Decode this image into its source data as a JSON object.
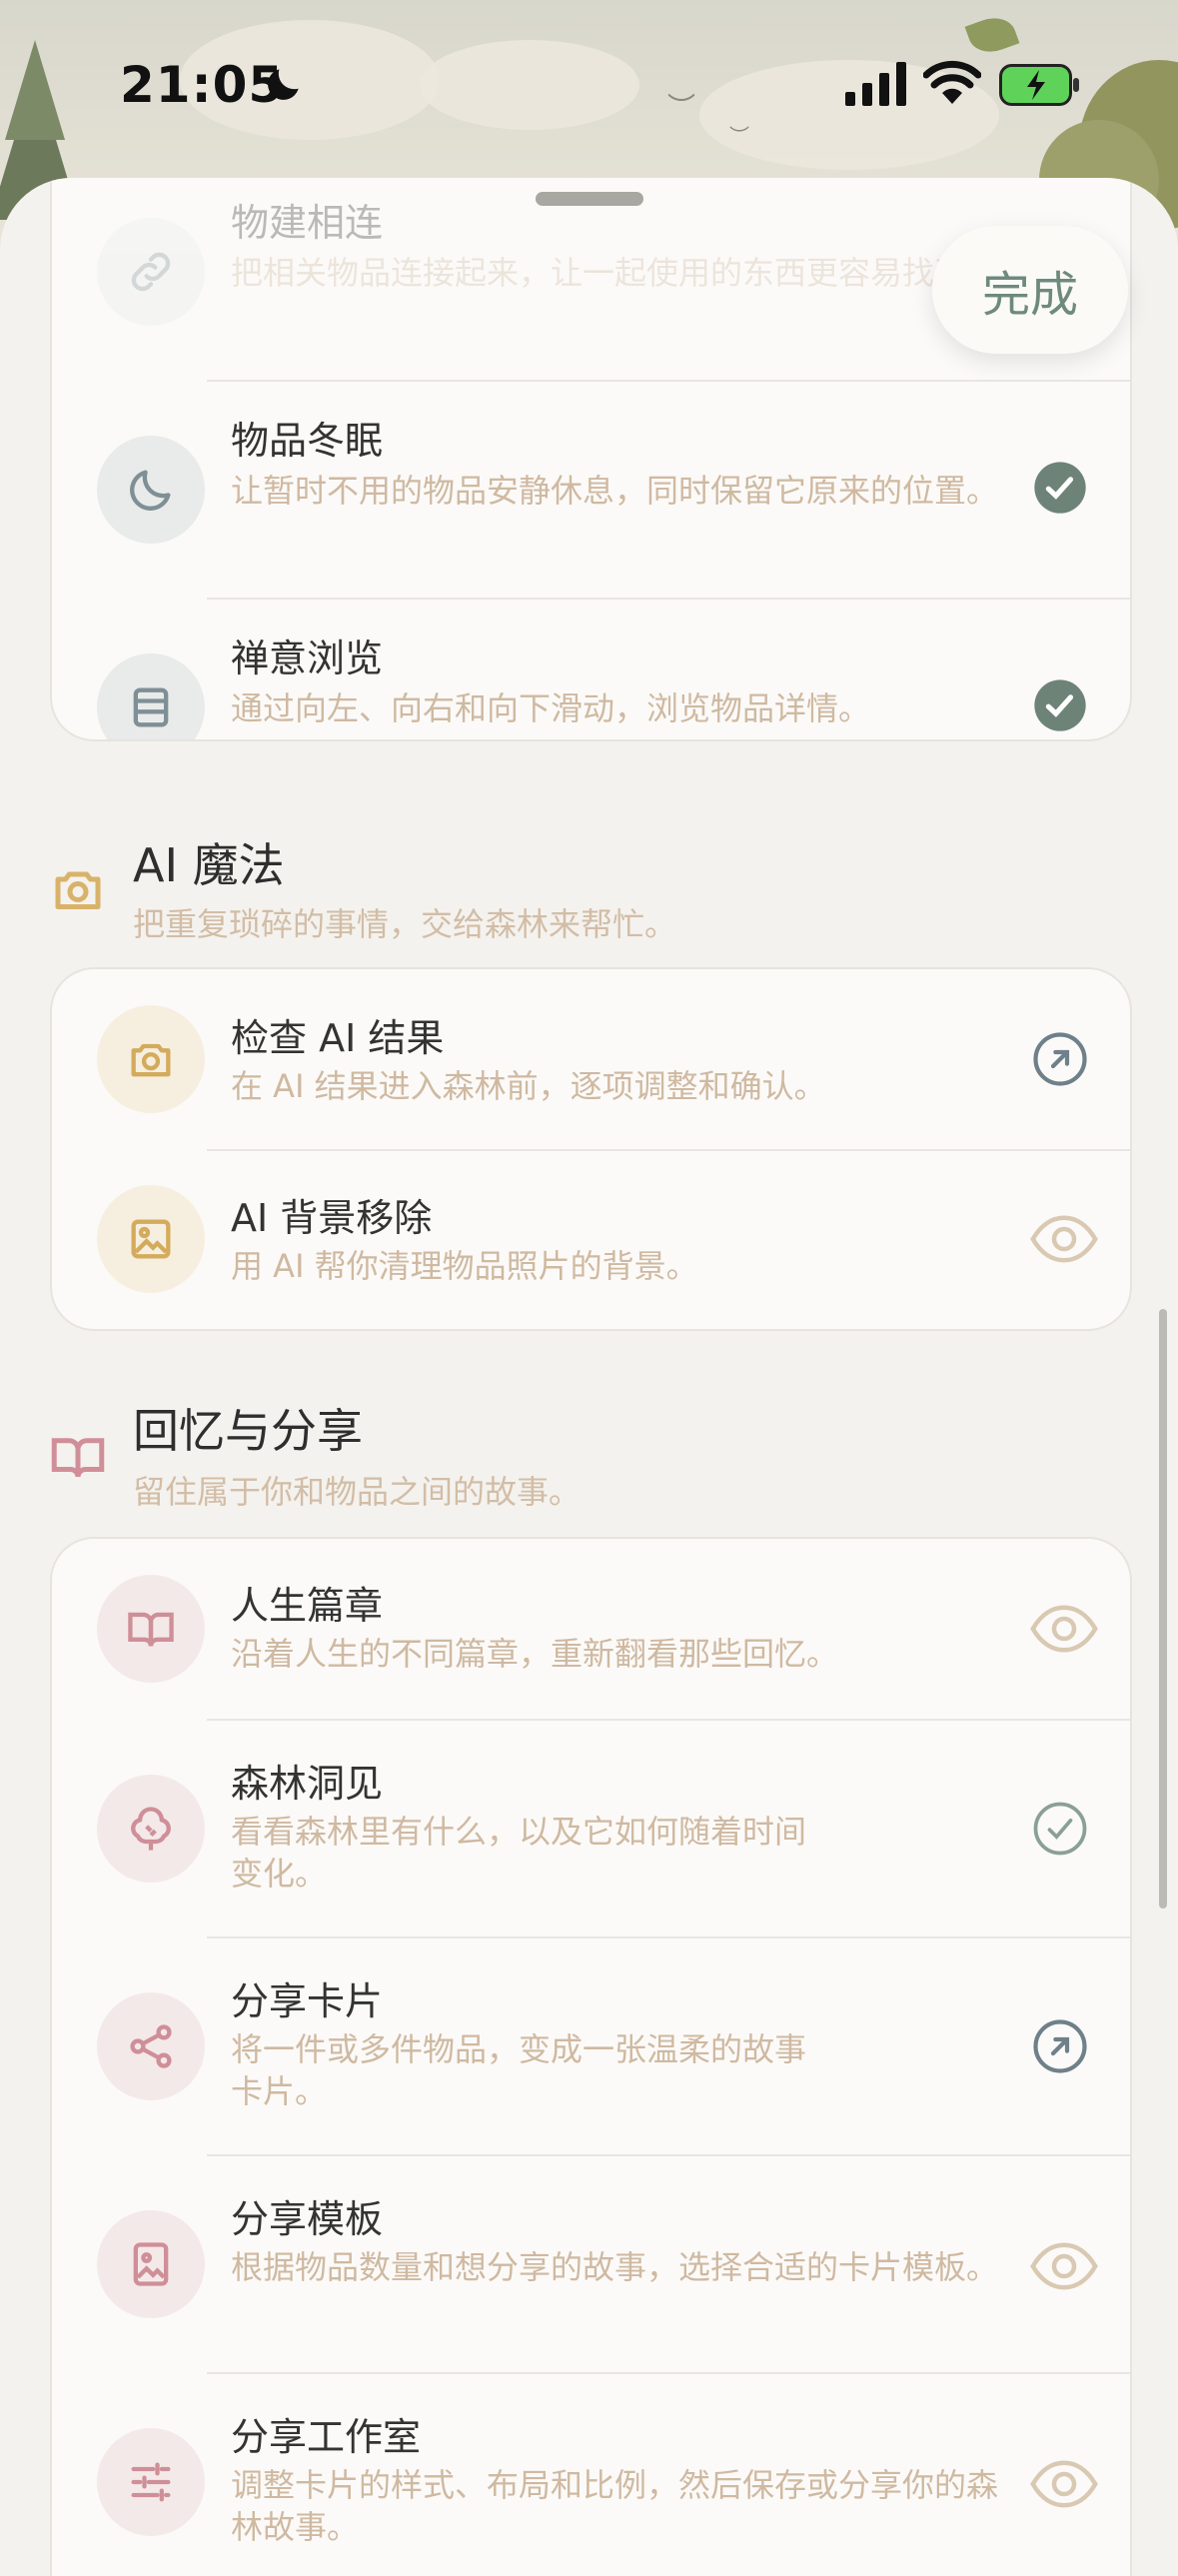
{
  "status_bar": {
    "time": "21:05"
  },
  "sheet": {
    "done_label": "完成"
  },
  "section_top": {
    "rows": [
      {
        "title": "物建相连",
        "desc": "把相关物品连接起来，让一起使用的东西更容易找到。",
        "icon": "link-icon",
        "status": "checked"
      },
      {
        "title": "物品冬眠",
        "desc": "让暂时不用的物品安静休息，同时保留它原来的位置。",
        "icon": "moon-icon",
        "status": "checked"
      },
      {
        "title": "禅意浏览",
        "desc": "通过向左、向右和向下滑动，浏览物品详情。",
        "icon": "list-icon",
        "status": "checked"
      }
    ]
  },
  "section_ai": {
    "title": "AI 魔法",
    "subtitle": "把重复琐碎的事情，交给森林来帮忙。",
    "rows": [
      {
        "title": "检查 AI 结果",
        "desc": "在 AI 结果进入森林前，逐项调整和确认。",
        "icon": "camera-icon",
        "status": "open"
      },
      {
        "title": "AI 背景移除",
        "desc": "用 AI 帮你清理物品照片的背景。",
        "icon": "image-icon",
        "status": "preview"
      }
    ]
  },
  "section_memory": {
    "title": "回忆与分享",
    "subtitle": "留住属于你和物品之间的故事。",
    "rows": [
      {
        "title": "人生篇章",
        "desc": "沿着人生的不同篇章，重新翻看那些回忆。",
        "icon": "book-icon",
        "status": "preview"
      },
      {
        "title": "森林洞见",
        "desc": "看看森林里有什么，以及它如何随着时间变化。",
        "icon": "tree-icon",
        "status": "check-outline"
      },
      {
        "title": "分享卡片",
        "desc": "将一件或多件物品，变成一张温柔的故事卡片。",
        "icon": "share-icon",
        "status": "open"
      },
      {
        "title": "分享模板",
        "desc": "根据物品数量和想分享的故事，选择合适的卡片模板。",
        "icon": "template-icon",
        "status": "preview"
      },
      {
        "title": "分享工作室",
        "desc": "调整卡片的样式、布局和比例，然后保存或分享你的森林故事。",
        "icon": "sliders-icon",
        "status": "preview"
      }
    ]
  }
}
